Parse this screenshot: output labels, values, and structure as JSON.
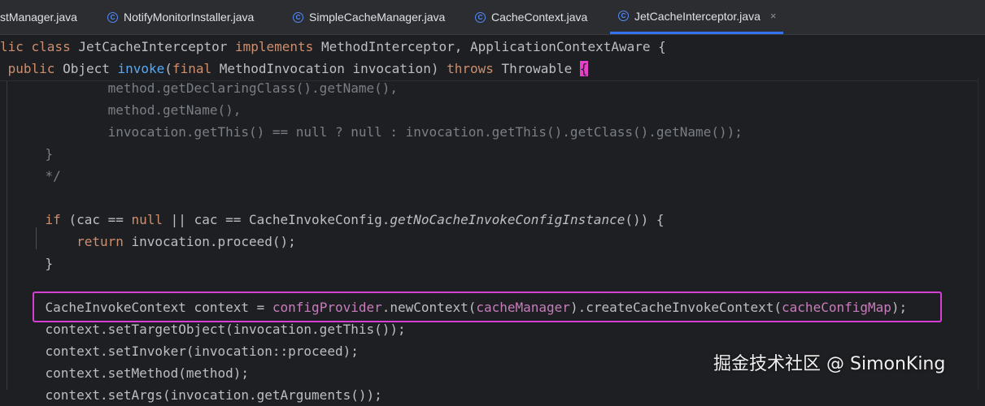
{
  "tabs": [
    {
      "label": "stManager.java"
    },
    {
      "label": "NotifyMonitorInstaller.java"
    },
    {
      "label": "SimpleCacheManager.java"
    },
    {
      "label": "CacheContext.java"
    },
    {
      "label": "JetCacheInterceptor.java",
      "close": "×"
    }
  ],
  "header": {
    "class_line": {
      "t1": "lic ",
      "t2": "class ",
      "t3": "JetCacheInterceptor ",
      "t4": "implements ",
      "t5": "MethodInterceptor, ApplicationContextAware {"
    },
    "method_line": {
      "t1": " public ",
      "t2": "Object ",
      "t3": "invoke",
      "t4": "(",
      "t5": "final ",
      "t6": "MethodInvocation invocation) ",
      "t7": "throws ",
      "t8": "Throwable ",
      "t9": "{"
    }
  },
  "code": {
    "c1": "            method.getDeclaringClass().getName(),",
    "c2": "            method.getName(),",
    "c3": "            invocation.getThis() == null ? null : invocation.getThis().getClass().getName());",
    "c4": "    }",
    "c5": "    */",
    "if_line": {
      "kw_if": "    if ",
      "a": "(cac == ",
      "null": "null",
      "b": " || cac == CacheInvokeConfig.",
      "call": "getNoCacheInvokeConfigInstance",
      "c": "()) {"
    },
    "ret_line": {
      "kw": "        return ",
      "rest": "invocation.proceed();"
    },
    "close_brace": "    }",
    "ctx_line": {
      "a": "    CacheInvokeContext context = ",
      "f1": "configProvider",
      "b": ".newContext(",
      "f2": "cacheManager",
      "c": ").createCacheInvokeContext(",
      "f3": "cacheConfigMap",
      "d": ");"
    },
    "l_target": "    context.setTargetObject(invocation.getThis());",
    "l_invoker": "    context.setInvoker(invocation::proceed);",
    "l_method": "    context.setMethod(method);",
    "l_args": "    context.setArgs(invocation.getArguments());"
  },
  "watermark": "掘金技术社区 @ SimonKing"
}
